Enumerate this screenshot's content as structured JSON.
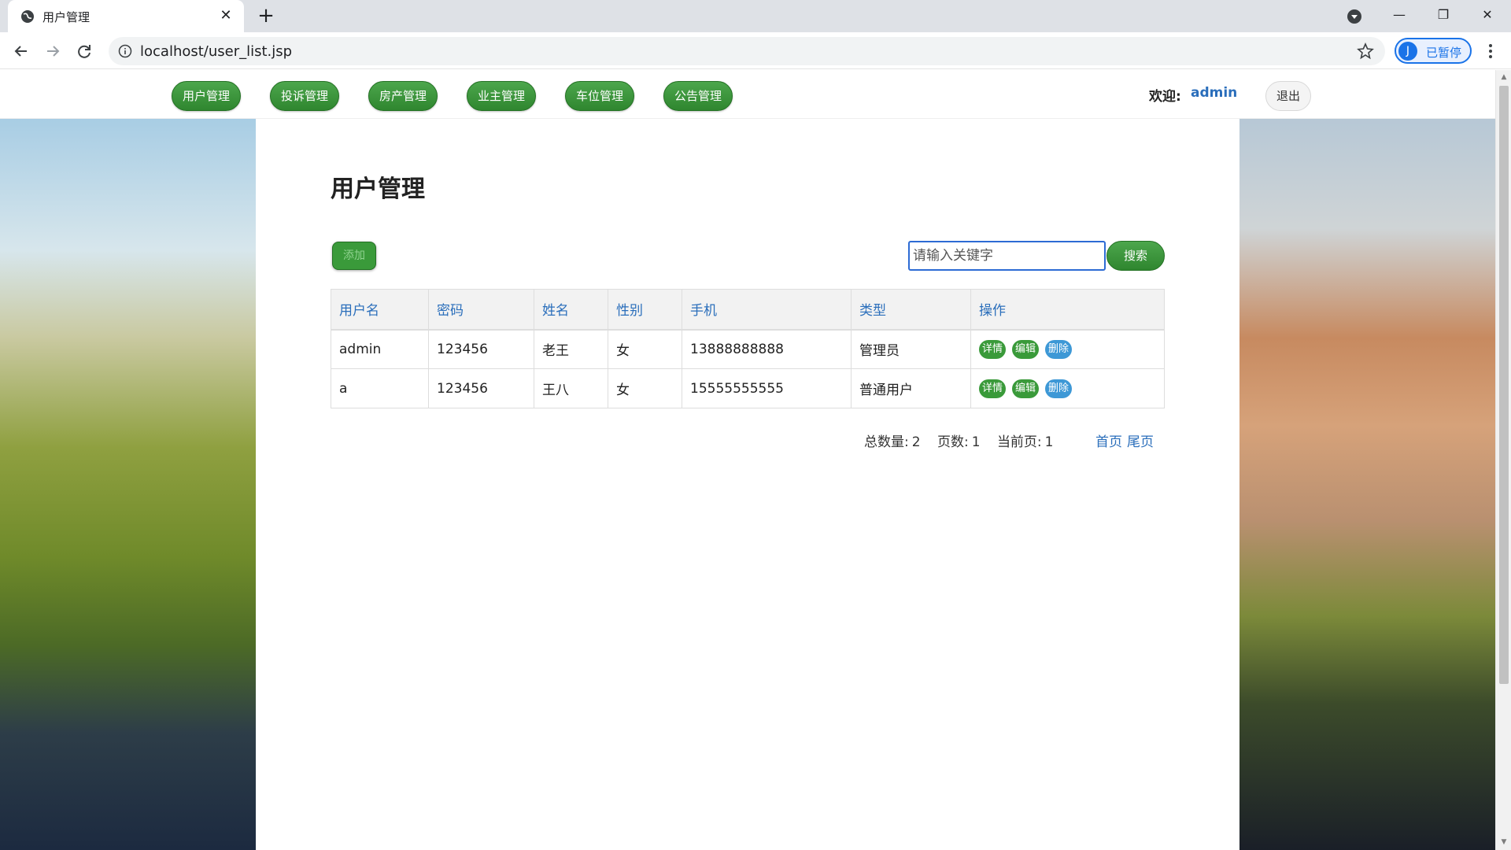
{
  "browser": {
    "tab_title": "用户管理",
    "url": "localhost/user_list.jsp",
    "profile_initial": "J",
    "profile_label": "已暂停"
  },
  "nav": {
    "items": [
      {
        "label": "用户管理"
      },
      {
        "label": "投诉管理"
      },
      {
        "label": "房产管理"
      },
      {
        "label": "业主管理"
      },
      {
        "label": "车位管理"
      },
      {
        "label": "公告管理"
      }
    ],
    "welcome_label": "欢迎:",
    "username": "admin",
    "logout_label": "退出"
  },
  "main": {
    "title": "用户管理",
    "add_label": "添加",
    "search_placeholder": "请输入关键字",
    "search_label": "搜索",
    "table": {
      "headers": [
        "用户名",
        "密码",
        "姓名",
        "性别",
        "手机",
        "类型",
        "操作"
      ],
      "rows": [
        {
          "username": "admin",
          "password": "123456",
          "name": "老王",
          "gender": "女",
          "phone": "13888888888",
          "type": "管理员"
        },
        {
          "username": "a",
          "password": "123456",
          "name": "王八",
          "gender": "女",
          "phone": "15555555555",
          "type": "普通用户"
        }
      ],
      "actions": {
        "detail": "详情",
        "edit": "编辑",
        "delete": "删除"
      }
    },
    "pager": {
      "total_label": "总数量:",
      "total": "2",
      "pages_label": "页数:",
      "pages": "1",
      "current_label": "当前页:",
      "current": "1",
      "first_label": "首页",
      "last_label": "尾页"
    }
  },
  "colors": {
    "nav_green": "#3a9a3a",
    "link_blue": "#2a6ebb",
    "delete_blue": "#3d98d6"
  }
}
